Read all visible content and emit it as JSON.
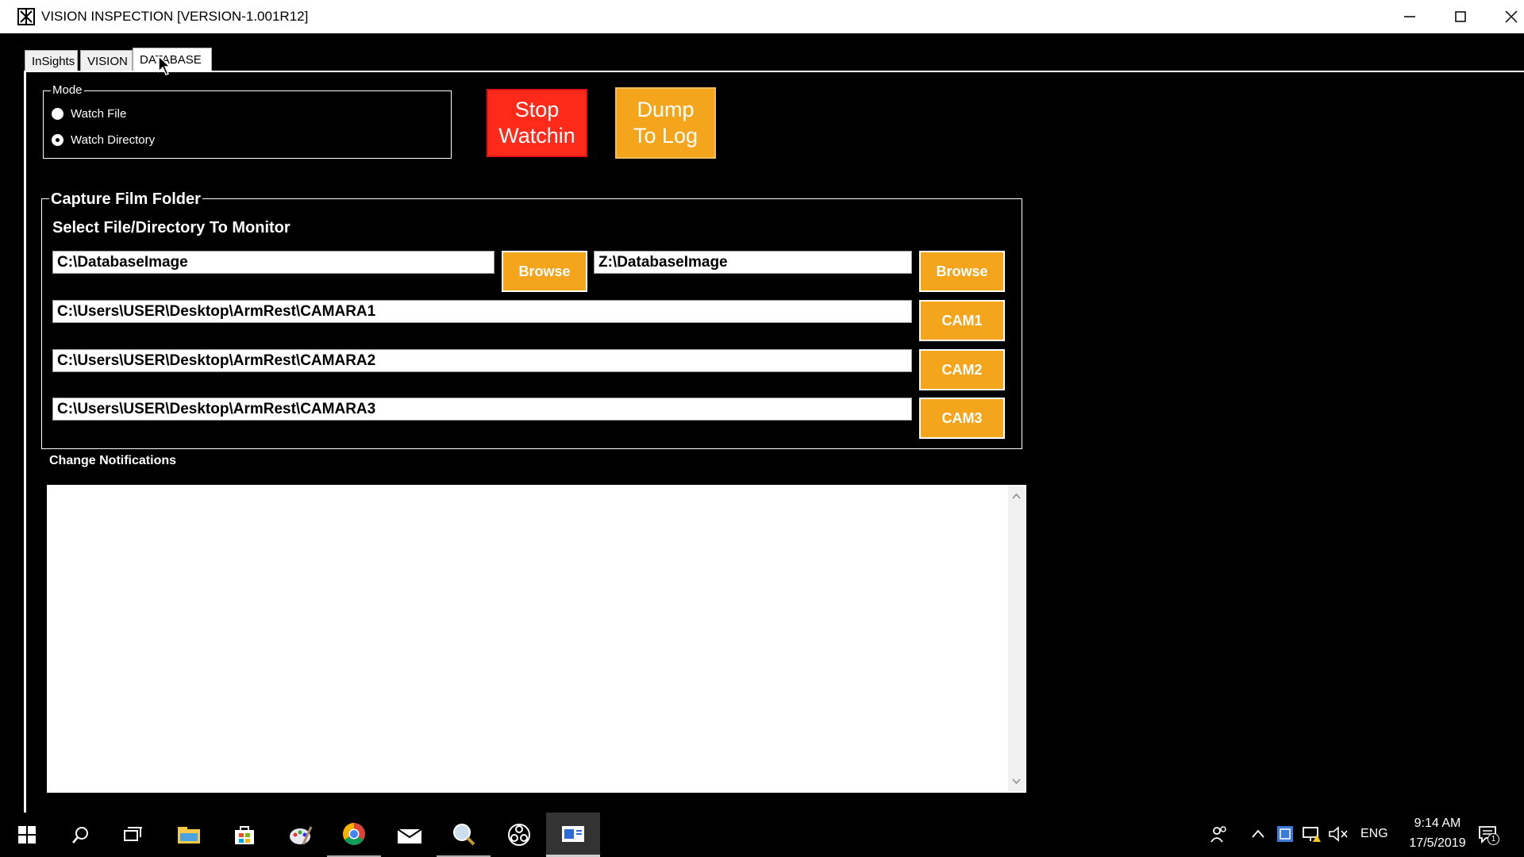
{
  "window": {
    "title": "VISION INSPECTION [VERSION-1.001R12]"
  },
  "tabs": [
    {
      "label": "InSights"
    },
    {
      "label": "VISION"
    },
    {
      "label": "DATABASE",
      "active": true
    }
  ],
  "mode": {
    "legend": "Mode",
    "options": [
      {
        "label": "Watch File",
        "selected": false
      },
      {
        "label": "Watch Directory",
        "selected": true
      }
    ]
  },
  "actions": {
    "stop_label": "Stop\nWatchin",
    "dump_label": "Dump\nTo Log",
    "stop_color": "#ff2a1a",
    "dump_color": "#f5a51b"
  },
  "capture": {
    "legend": "Capture Film Folder",
    "subtitle": "Select File/Directory To Monitor",
    "local_path": "C:\\DatabaseImage",
    "remote_path": "Z:\\DatabaseImage",
    "browse_label": "Browse",
    "cams": [
      {
        "path": "C:\\Users\\USER\\Desktop\\ArmRest\\CAMARA1",
        "button": "CAM1"
      },
      {
        "path": "C:\\Users\\USER\\Desktop\\ArmRest\\CAMARA2",
        "button": "CAM2"
      },
      {
        "path": "C:\\Users\\USER\\Desktop\\ArmRest\\CAMARA3",
        "button": "CAM3"
      }
    ]
  },
  "notifications": {
    "label": "Change Notifications",
    "content": ""
  },
  "taskbar": {
    "apps": [
      "windows-start-icon",
      "search-icon",
      "task-view-icon",
      "file-explorer-icon",
      "store-icon",
      "paint-icon",
      "chrome-icon",
      "mail-icon",
      "magnifier-icon",
      "obs-icon",
      "vision-app-icon"
    ],
    "language": "ENG",
    "time": "9:14 AM",
    "date": "17/5/2019",
    "notification_count": "1"
  }
}
